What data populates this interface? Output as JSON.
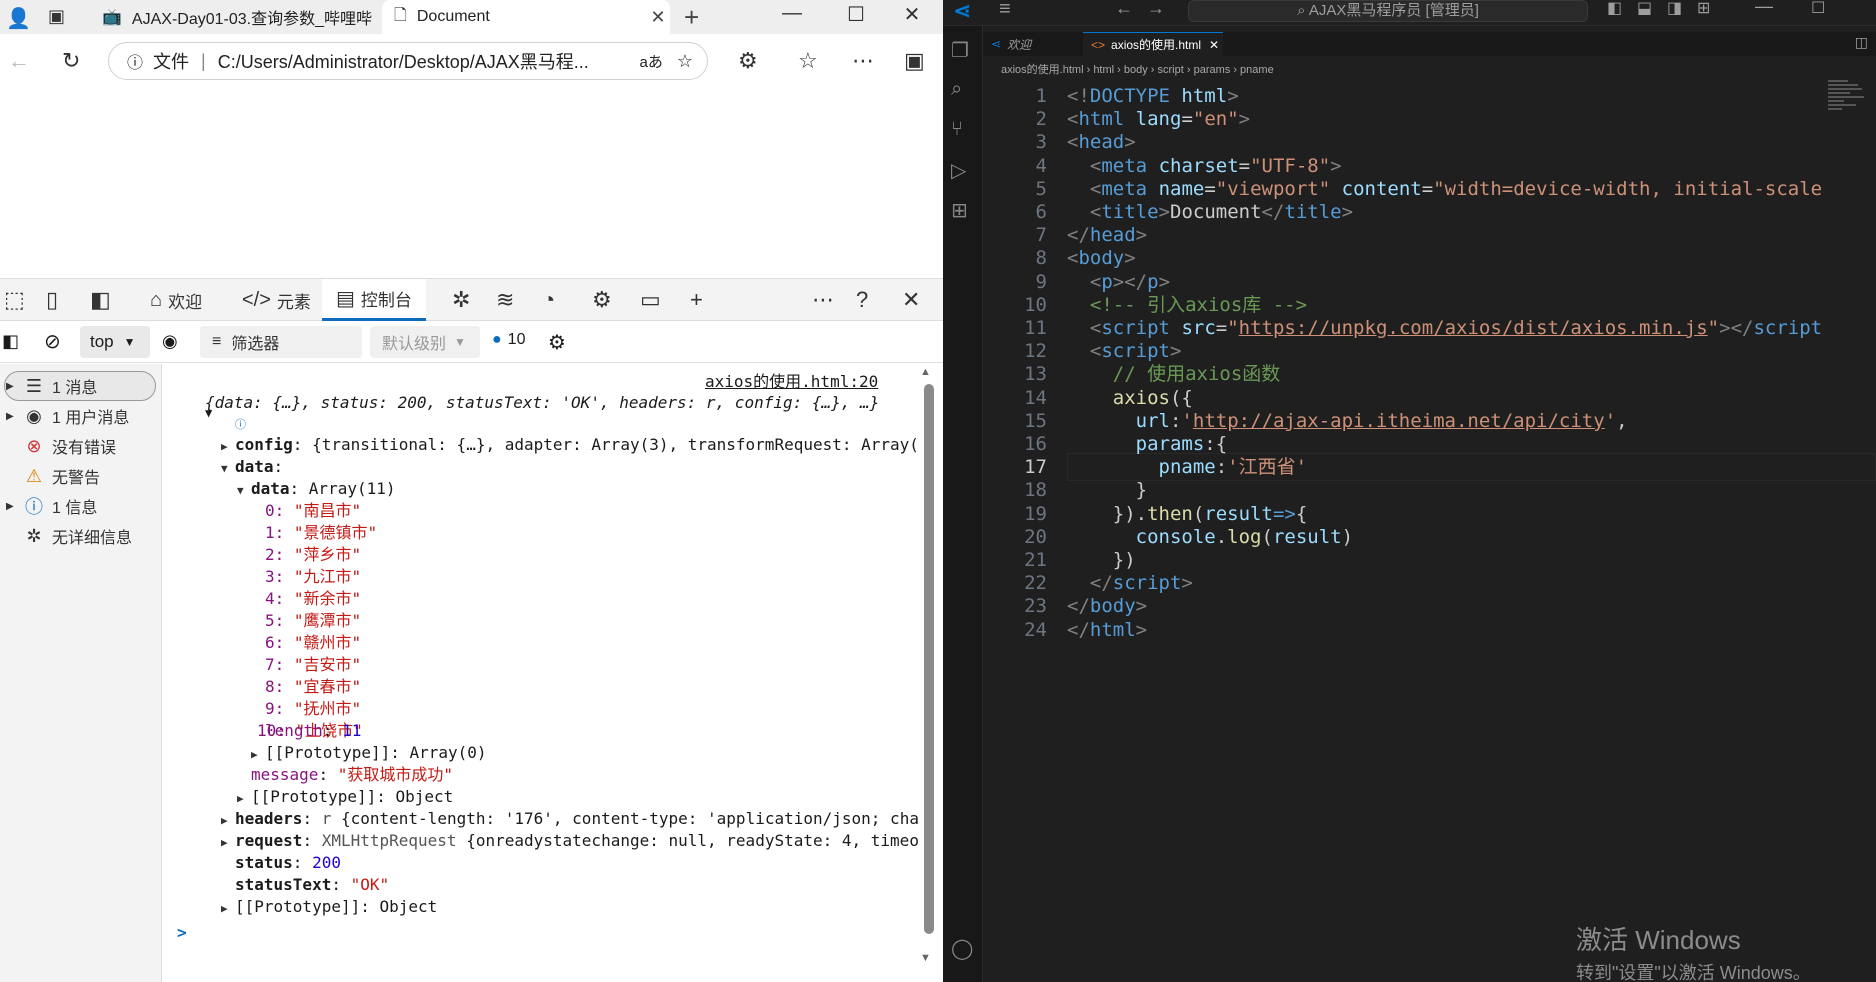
{
  "browser": {
    "tabs": [
      {
        "title": "AJAX-Day01-03.查询参数_哔哩哔"
      },
      {
        "title": "Document",
        "close": "✕"
      }
    ],
    "address": {
      "label": "文件",
      "url": "C:/Users/Administrator/Desktop/AJAX黑马程..."
    },
    "devtools": {
      "tabs": {
        "welcome": "欢迎",
        "elements": "元素",
        "console": "控制台"
      },
      "toolbar": {
        "context": "top",
        "filter": "筛选器",
        "level": "默认级别",
        "issues_count": "10"
      },
      "sidebar": [
        {
          "label": "1 消息"
        },
        {
          "label": "1 用户消息"
        },
        {
          "label": "没有错误"
        },
        {
          "label": "无警告"
        },
        {
          "label": "1 信息"
        },
        {
          "label": "无详细信息"
        }
      ],
      "console": {
        "source_link": "axios的使用.html:20",
        "summary": "{data: {…}, status: 200, statusText: 'OK', headers: r, config: {…}, …}",
        "config_line": "{transitional: {…}, adapter: Array(3), transformRequest: Array(",
        "data_array": "Array(11)",
        "cities": [
          "\"南昌市\"",
          "\"景德镇市\"",
          "\"萍乡市\"",
          "\"九江市\"",
          "\"新余市\"",
          "\"鹰潭市\"",
          "\"赣州市\"",
          "\"吉安市\"",
          "\"宜春市\"",
          "\"抚州市\"",
          "\"上饶市\""
        ],
        "length": "11",
        "proto_array": "Array(0)",
        "message": "\"获取城市成功\"",
        "proto_object": "Object",
        "headers_line": "{content-length: '176', content-type: 'application/json; cha",
        "request_line": "{onreadystatechange: null, readyState: 4, timeo",
        "request_type": "XMLHttpRequest",
        "status": "200",
        "statusText": "\"OK\"",
        "proto_object2": "Object",
        "prompt": ">"
      }
    }
  },
  "vscode": {
    "search": "AJAX黑马程序员 [管理员]",
    "tabs": [
      {
        "title": "欢迎"
      },
      {
        "title": "axios的使用.html",
        "close": "✕"
      }
    ],
    "breadcrumbs": [
      "axios的使用.html",
      "html",
      "body",
      "script",
      "params",
      "pname"
    ],
    "watermark": {
      "line1": "激活 Windows",
      "line2": "转到\"设置\"以激活 Windows。"
    },
    "current_line": 17
  },
  "colors": {
    "accent": "#0f6cbd",
    "vscode_bg": "#1f1f1f",
    "string": "#ce9178",
    "tag": "#569cd6"
  }
}
